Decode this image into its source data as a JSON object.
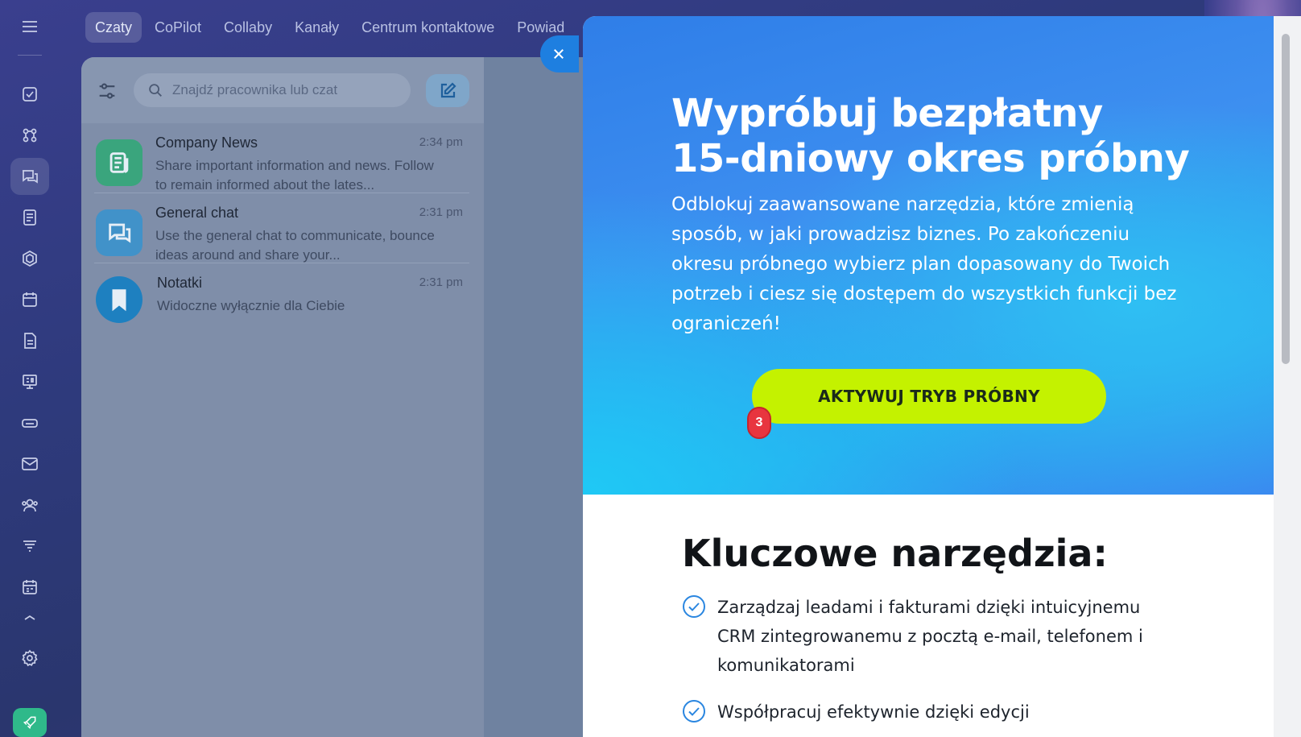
{
  "sidebar": {
    "items": [
      {
        "icon": "menu-icon"
      },
      {
        "icon": "tasks-icon"
      },
      {
        "icon": "network-icon"
      },
      {
        "icon": "chat-icon",
        "active": true
      },
      {
        "icon": "feed-icon"
      },
      {
        "icon": "shield-icon"
      },
      {
        "icon": "calendar-icon"
      },
      {
        "icon": "document-icon"
      },
      {
        "icon": "presentation-icon"
      },
      {
        "icon": "inbox-icon"
      },
      {
        "icon": "mail-icon"
      },
      {
        "icon": "users-icon"
      },
      {
        "icon": "filter-funnel-icon"
      },
      {
        "icon": "planner-icon"
      },
      {
        "icon": "collapse-icon"
      },
      {
        "icon": "settings-icon"
      },
      {
        "icon": "rocket-icon"
      }
    ]
  },
  "tabs": [
    {
      "label": "Czaty",
      "active": true
    },
    {
      "label": "CoPilot"
    },
    {
      "label": "Collaby"
    },
    {
      "label": "Kanały"
    },
    {
      "label": "Centrum kontaktowe"
    },
    {
      "label": "Powiad"
    }
  ],
  "chat": {
    "search_placeholder": "Znajdź pracownika lub czat",
    "items": [
      {
        "title": "Company News",
        "time": "2:34 pm",
        "preview": "Share important information and news. Follow to remain informed about the lates..."
      },
      {
        "title": "General chat",
        "time": "2:31 pm",
        "preview": "Use the general chat to communicate, bounce ideas around and share your..."
      },
      {
        "title": "Notatki",
        "time": "2:31 pm",
        "preview": "Widoczne wyłącznie dla Ciebie"
      }
    ]
  },
  "modal": {
    "title_line1": "Wypróbuj bezpłatny",
    "title_line2": "15-dniowy okres próbny",
    "description": "Odblokuj zaawansowane narzędzia, które zmienią sposób, w jaki prowadzisz biznes. Po zakończeniu okresu próbnego wybierz plan dopasowany do Twoich potrzeb i ciesz się dostępem do wszystkich funkcji bez ograniczeń!",
    "cta_label": "AKTYWUJ TRYB PRÓBNY",
    "badge": "3",
    "section_title": "Kluczowe narzędzia:",
    "features": [
      "Zarządzaj leadami i fakturami dzięki intuicyjnemu CRM zintegrowanemu z pocztą e-mail, telefonem i komunikatorami",
      "Współpracuj efektywnie dzięki edycji"
    ]
  },
  "colors": {
    "accent": "#1e7fe0",
    "cta": "#c4f200",
    "badge": "#e8353f"
  }
}
